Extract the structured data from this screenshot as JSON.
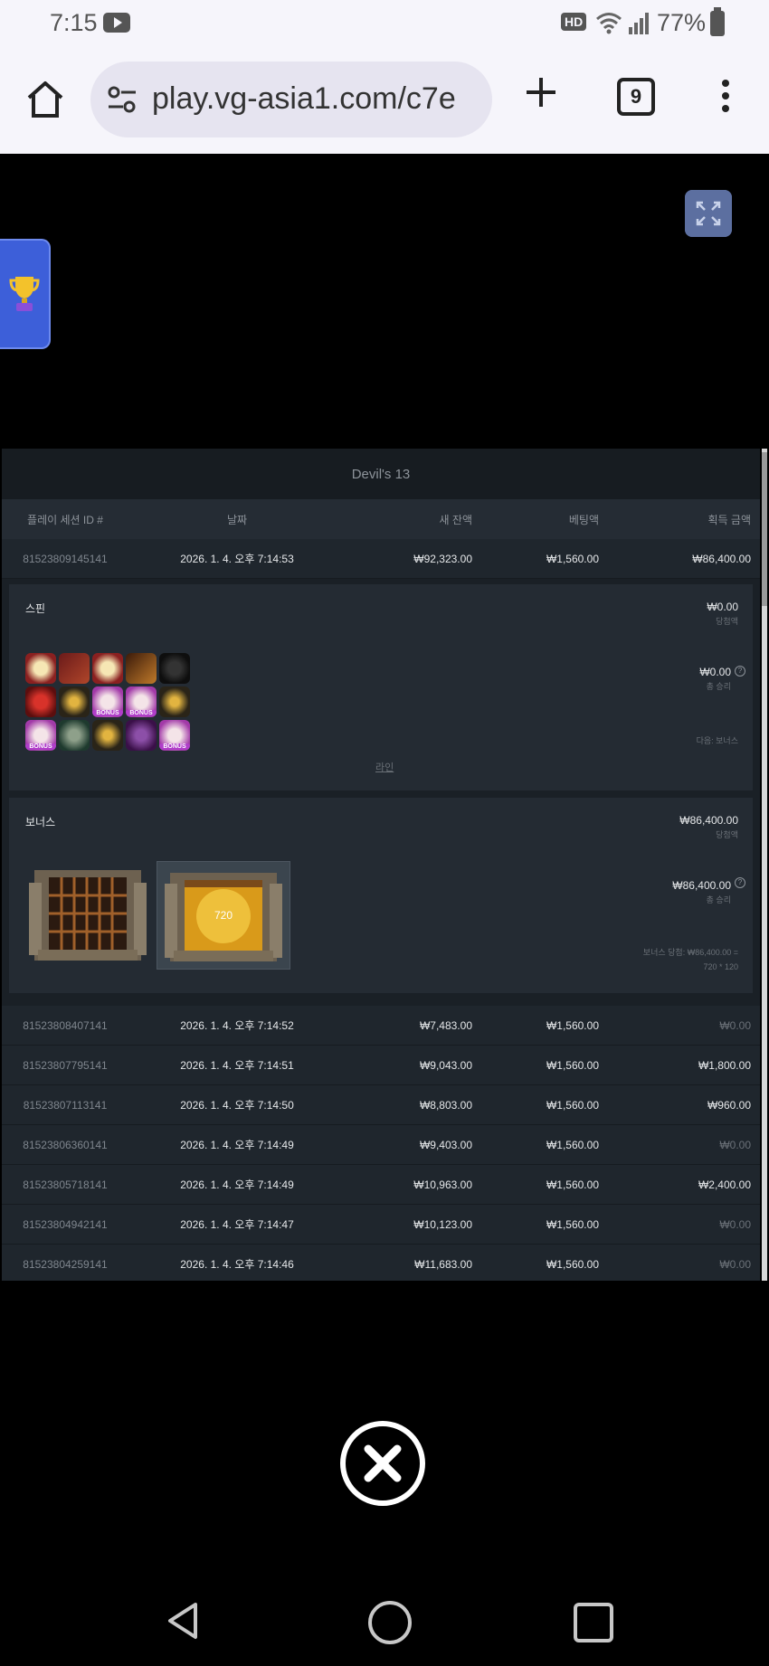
{
  "status_bar": {
    "time": "7:15",
    "battery": "77%",
    "hd": "HD"
  },
  "browser": {
    "url": "play.vg-asia1.com/c7e",
    "tab_count": "9"
  },
  "history": {
    "title": "Devil's 13",
    "columns": [
      "플레이 세션 ID #",
      "날짜",
      "새 잔액",
      "베팅액",
      "획득 금액"
    ],
    "expanded_row": {
      "id": "81523809145141",
      "date": "2026. 1. 4. 오후 7:14:53",
      "balance": "₩92,323.00",
      "bet": "₩1,560.00",
      "win": "₩86,400.00"
    },
    "spin": {
      "title": "스핀",
      "value1": "₩0.00",
      "label1": "당첨액",
      "value2": "₩0.00",
      "label2": "총 승리",
      "next": "다음: 보너스",
      "line_link": "라인",
      "symbol_label": "BONUS"
    },
    "bonus": {
      "title": "보너스",
      "value1": "₩86,400.00",
      "label1": "당첨액",
      "value2": "₩86,400.00",
      "label2": "총 승리",
      "note1": "보너스 당첨: ₩86,400.00 =",
      "note2": "720 * 120",
      "gate_value": "720"
    },
    "rows": [
      {
        "id": "81523808407141",
        "date": "2026. 1. 4. 오후 7:14:52",
        "balance": "₩7,483.00",
        "bet": "₩1,560.00",
        "win": "₩0.00"
      },
      {
        "id": "81523807795141",
        "date": "2026. 1. 4. 오후 7:14:51",
        "balance": "₩9,043.00",
        "bet": "₩1,560.00",
        "win": "₩1,800.00"
      },
      {
        "id": "81523807113141",
        "date": "2026. 1. 4. 오후 7:14:50",
        "balance": "₩8,803.00",
        "bet": "₩1,560.00",
        "win": "₩960.00"
      },
      {
        "id": "81523806360141",
        "date": "2026. 1. 4. 오후 7:14:49",
        "balance": "₩9,403.00",
        "bet": "₩1,560.00",
        "win": "₩0.00"
      },
      {
        "id": "81523805718141",
        "date": "2026. 1. 4. 오후 7:14:49",
        "balance": "₩10,963.00",
        "bet": "₩1,560.00",
        "win": "₩2,400.00"
      },
      {
        "id": "81523804942141",
        "date": "2026. 1. 4. 오후 7:14:47",
        "balance": "₩10,123.00",
        "bet": "₩1,560.00",
        "win": "₩0.00"
      },
      {
        "id": "81523804259141",
        "date": "2026. 1. 4. 오후 7:14:46",
        "balance": "₩11,683.00",
        "bet": "₩1,560.00",
        "win": "₩0.00"
      }
    ]
  },
  "icons": {
    "status": [
      "youtube-icon",
      "hd-icon",
      "wifi-icon",
      "signal-icon",
      "battery-icon"
    ],
    "browser": [
      "home-icon",
      "site-settings-icon",
      "plus-icon",
      "tabs-icon",
      "more-vert-icon"
    ],
    "game": [
      "expand-icon",
      "trophy-icon",
      "close-icon"
    ],
    "nav": [
      "back-icon",
      "home-circle-icon",
      "recent-apps-icon"
    ]
  },
  "colors": {
    "accent_blue": "#3d5fd9",
    "panel": "#1f262d",
    "expand_button": "#5c6fa0"
  }
}
